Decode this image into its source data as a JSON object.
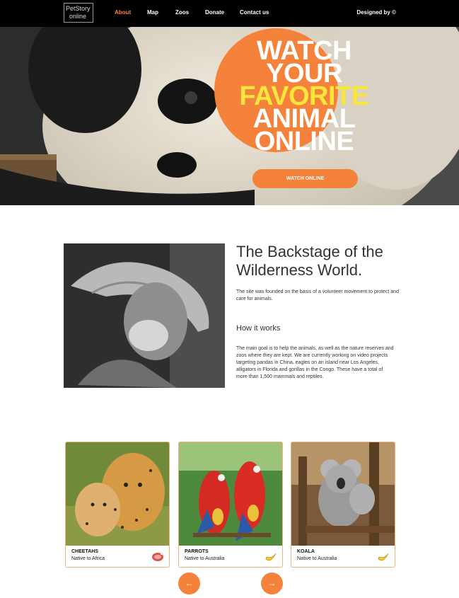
{
  "header": {
    "logo_line1": "PetStory",
    "logo_line2": "online",
    "nav": [
      {
        "label": "About",
        "active": true
      },
      {
        "label": "Map"
      },
      {
        "label": "Zoos"
      },
      {
        "label": "Donate"
      },
      {
        "label": "Contact us"
      }
    ],
    "designed_by": "Designed by ©"
  },
  "hero": {
    "title_lines": [
      "WATCH",
      "YOUR",
      "FAVORITE",
      "ANIMAL",
      "ONLINE"
    ],
    "button_label": "WATCH ONLINE"
  },
  "about": {
    "title": "The Backstage of the Wilderness World.",
    "description": "The site was founded on the basis of a volunteer movement to protect and care for animals.",
    "how_title": "How it works",
    "how_text": "The main goal is to help the animals, as well as the nature reserves and zoos where they are kept. We are currently working on video projects targeting pandas in China, eagles on an island near Los Angeles, alligators in Florida and gorillas in the Congo. These have a total of more than 1,500 mammals and reptiles."
  },
  "cards": [
    {
      "name": "CHEETAHS",
      "native": "Native to Africa",
      "badge_icon": "meat-icon"
    },
    {
      "name": "PARROTS",
      "native": "Native to Australia",
      "badge_icon": "banana-icon"
    },
    {
      "name": "KOALA",
      "native": "Native to Australia",
      "badge_icon": "banana-icon"
    }
  ],
  "carousel": {
    "prev_symbol": "←",
    "next_symbol": "→"
  },
  "colors": {
    "accent": "#f5823a",
    "highlight": "#f7e63c",
    "header_bg": "#000000"
  }
}
